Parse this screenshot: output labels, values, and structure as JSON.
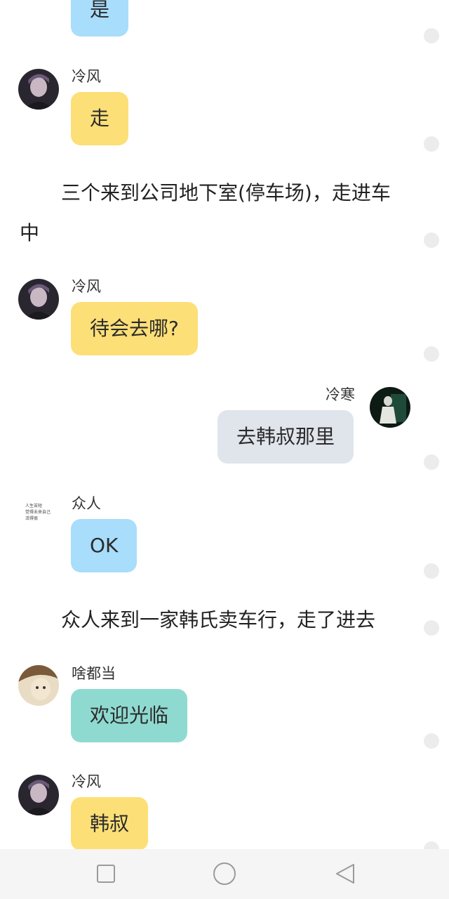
{
  "messages": [
    {
      "text": "是",
      "color": "#a8ddfb"
    },
    {
      "sender": "冷风",
      "text": "走",
      "color": "#fddf77"
    },
    {
      "sender": "冷风",
      "text": "待会去哪?",
      "color": "#fddf77"
    },
    {
      "sender": "冷寒",
      "text": "去韩叔那里",
      "color": "#e0e5ec"
    },
    {
      "sender": "众人",
      "text": "OK",
      "color": "#a8ddfb"
    },
    {
      "sender": "啥都当",
      "text": "欢迎光临",
      "color": "#8fdad0"
    },
    {
      "sender": "冷风",
      "text": "韩叔",
      "color": "#fddf77"
    }
  ],
  "narration": [
    {
      "line1": "三个来到公司地下室(停车场)，走进车",
      "line2": "中"
    },
    {
      "line1": "众人来到一家韩氏卖车行，走了进去"
    }
  ],
  "avatars": {
    "zhongren_text_line1": "人生苦短",
    "zhongren_text_line2": "觉得未来自己",
    "zhongren_text_line3": "活得很"
  },
  "navbar": {
    "icons": [
      "recent-apps-icon",
      "home-icon",
      "back-icon"
    ]
  }
}
